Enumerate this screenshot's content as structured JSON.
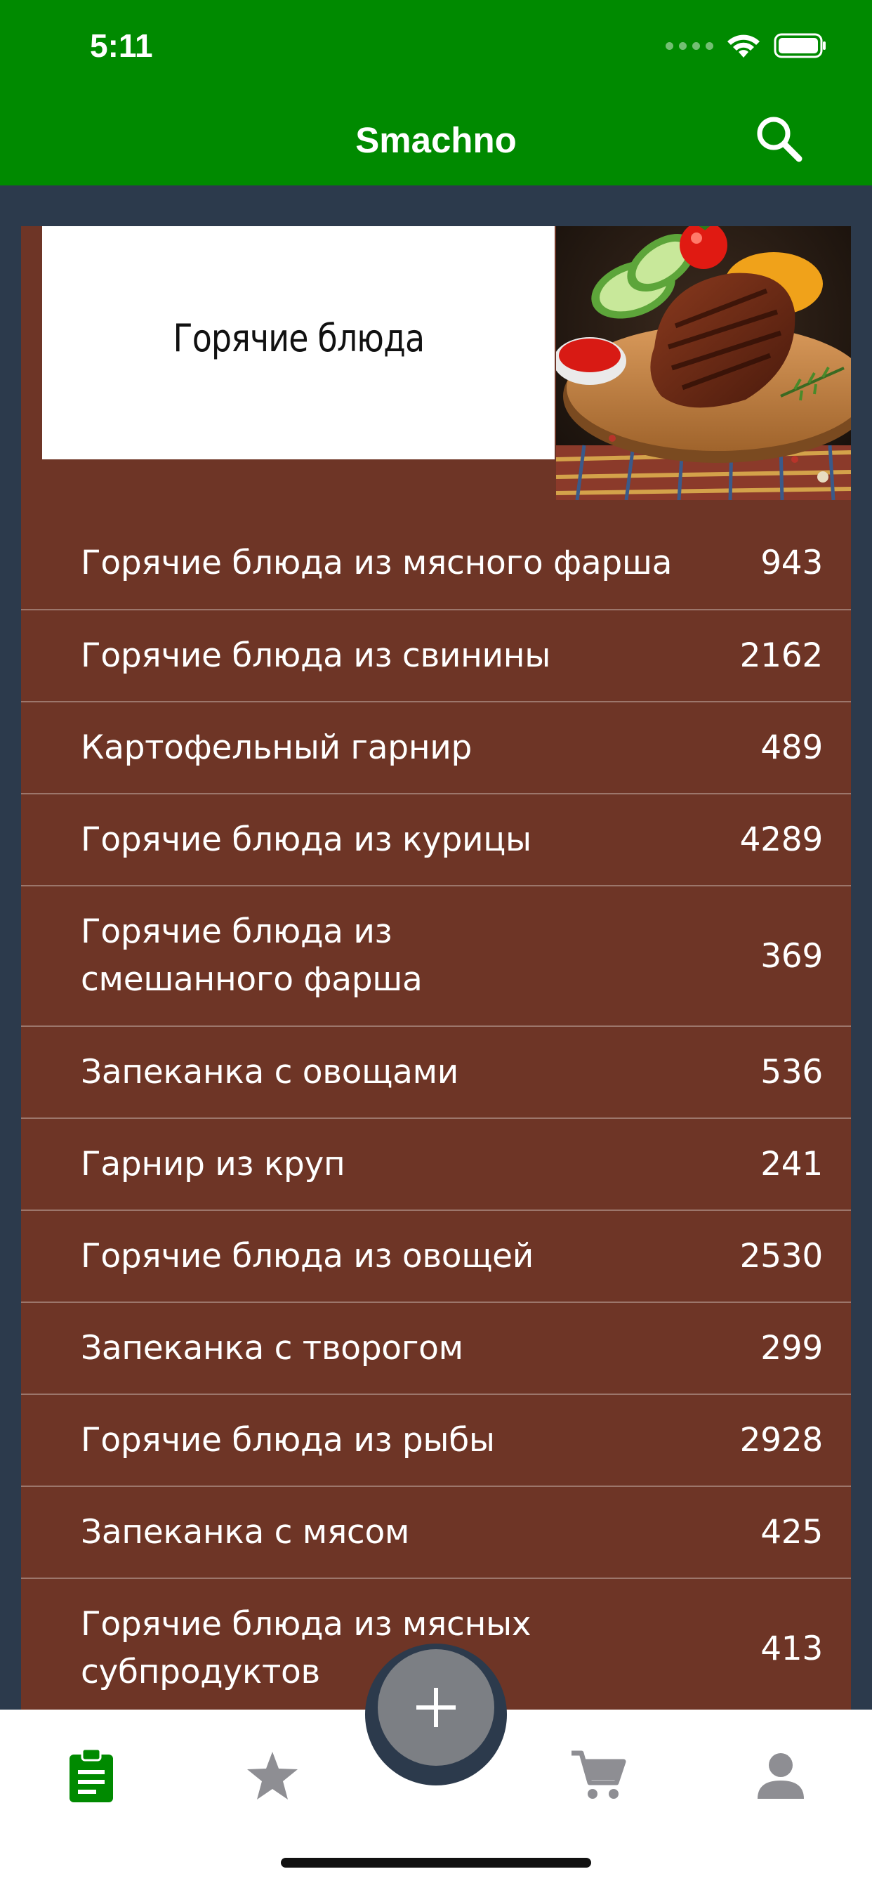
{
  "status_bar": {
    "time": "5:11"
  },
  "header": {
    "title": "Smachno",
    "search_icon": "search-icon"
  },
  "category": {
    "title": "Горячие блюда",
    "image": "grilled-steak-with-vegetables"
  },
  "items": [
    {
      "label": "Горячие блюда из мясного фарша",
      "count": "943"
    },
    {
      "label": "Горячие блюда из свинины",
      "count": "2162"
    },
    {
      "label": "Картофельный гарнир",
      "count": "489"
    },
    {
      "label": "Горячие блюда из курицы",
      "count": "4289"
    },
    {
      "label": "Горячие блюда из\nсмешанного фарша",
      "count": "369"
    },
    {
      "label": "Запеканка с овощами",
      "count": "536"
    },
    {
      "label": "Гарнир из круп",
      "count": "241"
    },
    {
      "label": "Горячие блюда из овощей",
      "count": "2530"
    },
    {
      "label": "Запеканка с творогом",
      "count": "299"
    },
    {
      "label": "Горячие блюда из рыбы",
      "count": "2928"
    },
    {
      "label": "Запеканка с мясом",
      "count": "425"
    },
    {
      "label": "Горячие блюда из мясных\nсубпродуктов",
      "count": "413"
    }
  ],
  "tabbar": {
    "tabs": [
      {
        "icon": "clipboard-icon",
        "active": true
      },
      {
        "icon": "star-icon",
        "active": false
      },
      {
        "icon": "plus-icon",
        "active": false
      },
      {
        "icon": "cart-icon",
        "active": false
      },
      {
        "icon": "person-icon",
        "active": false
      }
    ]
  },
  "colors": {
    "header": "#008a00",
    "card": "#6e3526",
    "background": "#2c3a4c",
    "tab_active": "#008a00",
    "tab_inactive": "#8e8e93"
  }
}
